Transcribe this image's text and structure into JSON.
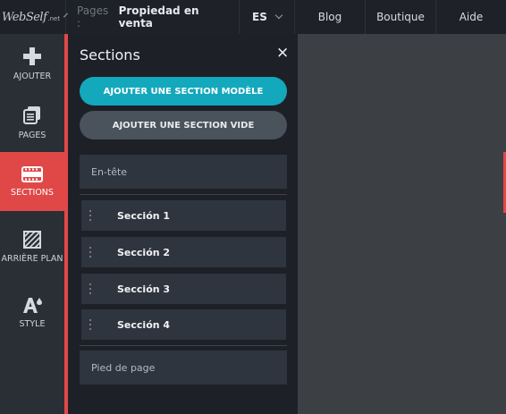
{
  "topbar": {
    "logo_text": "WebSelf",
    "logo_suffix": ".net",
    "pages_label": "Pages :",
    "pages_value": "Propiedad en venta",
    "language": "ES",
    "nav": [
      "Blog",
      "Boutique",
      "Aide"
    ]
  },
  "sidebar": {
    "items": [
      {
        "label": "AJOUTER",
        "icon": "plus-icon"
      },
      {
        "label": "PAGES",
        "icon": "pages-icon"
      },
      {
        "label": "SECTIONS",
        "icon": "sections-icon",
        "active": true
      },
      {
        "label": "ARRIÈRE PLAN",
        "icon": "background-icon"
      },
      {
        "label": "STYLE",
        "icon": "style-icon"
      }
    ],
    "active_color": "#e04848"
  },
  "panel": {
    "title": "Sections",
    "close": "×",
    "btn_template": "AJOUTER UNE SECTION MODÈLE",
    "btn_empty": "AJOUTER UNE SECTION VIDE",
    "header_label": "En-tête",
    "sections": [
      "Sección 1",
      "Sección 2",
      "Sección 3",
      "Sección 4"
    ],
    "footer_label": "Pied de page",
    "accent": "#14a8bd"
  }
}
